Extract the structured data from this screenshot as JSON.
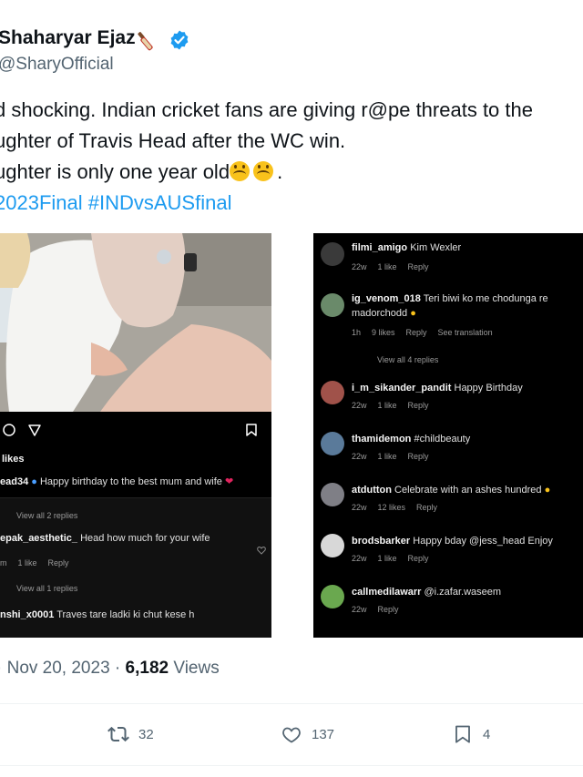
{
  "author": {
    "display_name": "Shaharyar Ejaz",
    "handle": "@SharyOfficial",
    "emoji_icon": "cricket-bat-icon",
    "verified_color": "#1d9bf0"
  },
  "tweet": {
    "lines": [
      "d shocking. Indian cricket fans are giving r@pe threats to the",
      "ughter of Travis Head after the WC win.",
      "ughter is only one year old"
    ],
    "line3_end": ".",
    "hashtags": "2023Final #INDvsAUSfinal",
    "emoji": "upside-down-face-icon"
  },
  "left_post": {
    "likes_label": "likes",
    "caption_user": "ead34",
    "caption_text": "Happy birthday to the best mum and wife",
    "view_replies_1": "View all 2 replies",
    "comment1_user": "epak_aesthetic_",
    "comment1_text": "Head how much for your wife",
    "comment1_time": "m",
    "comment1_likes": "1 like",
    "comment1_reply": "Reply",
    "view_replies_2": "View all 1 replies",
    "comment2_user": "nshi_x0001",
    "comment2_text": "Traves tare ladki ki chut kese h"
  },
  "right_post": {
    "comments": [
      {
        "user": "filmi_amigo",
        "text": "Kim Wexler",
        "time": "22w",
        "likes": "1 like",
        "reply": "Reply"
      },
      {
        "user": "ig_venom_018",
        "text": "Teri biwi ko me chodunga re",
        "text2": "madorchodd",
        "time": "1h",
        "likes": "9 likes",
        "reply": "Reply",
        "extra": "See translation"
      },
      {
        "user": "i_m_sikander_pandit",
        "text": "Happy Birthday",
        "time": "22w",
        "likes": "1 like",
        "reply": "Reply"
      },
      {
        "user": "thamidemon",
        "text": "#childbeauty",
        "time": "22w",
        "likes": "1 like",
        "reply": "Reply"
      },
      {
        "user": "atdutton",
        "text": "Celebrate with an ashes hundred",
        "time": "22w",
        "likes": "12 likes",
        "reply": "Reply"
      },
      {
        "user": "brodsbarker",
        "text": "Happy bday @jess_head Enjoy",
        "time": "22w",
        "likes": "1 like",
        "reply": "Reply"
      },
      {
        "user": "callmedilawarr",
        "text": "@i.zafar.waseem",
        "time": "22w",
        "reply": "Reply"
      }
    ],
    "view_replies": "View all 4 replies"
  },
  "meta": {
    "date": "Nov 20, 2023",
    "views_count": "6,182",
    "views_label": "Views"
  },
  "actions": {
    "retweets": "32",
    "likes": "137",
    "bookmarks": "4"
  }
}
